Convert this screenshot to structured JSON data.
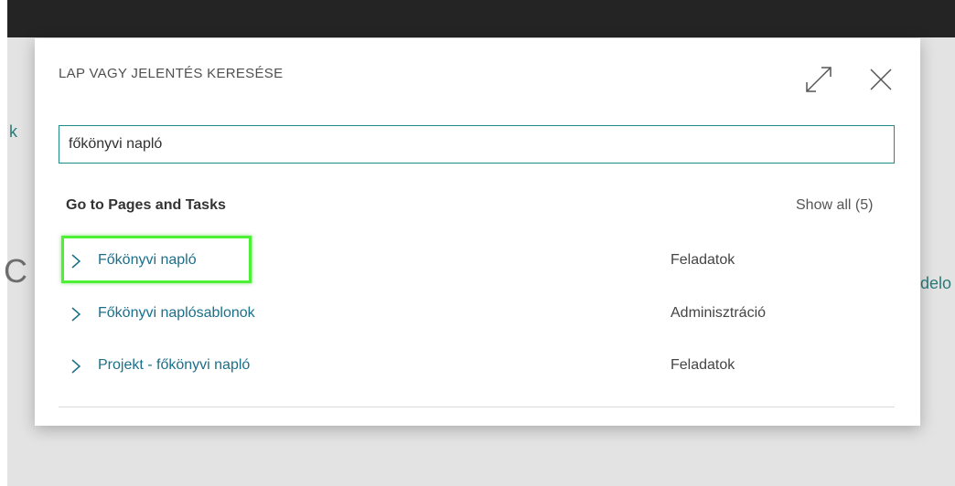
{
  "background": {
    "left_text": "k",
    "left_large_text": "C",
    "right_text": "delo"
  },
  "dialog": {
    "title": "LAP VAGY JELENTÉS KERESÉSE",
    "expand_icon": "expand-arrows-icon",
    "close_icon": "close-icon"
  },
  "search": {
    "value": "főkönyvi napló"
  },
  "results": {
    "section_title": "Go to Pages and Tasks",
    "show_all": "Show all (5)",
    "items": [
      {
        "name": "Főkönyvi napló",
        "category": "Feladatok"
      },
      {
        "name": "Főkönyvi naplósablonok",
        "category": "Adminisztráció"
      },
      {
        "name": "Projekt - főkönyvi napló",
        "category": "Feladatok"
      }
    ]
  },
  "colors": {
    "accent": "#1f8a86",
    "link": "#1a6f8a",
    "highlight": "#4cf035",
    "topbar": "#242424"
  }
}
